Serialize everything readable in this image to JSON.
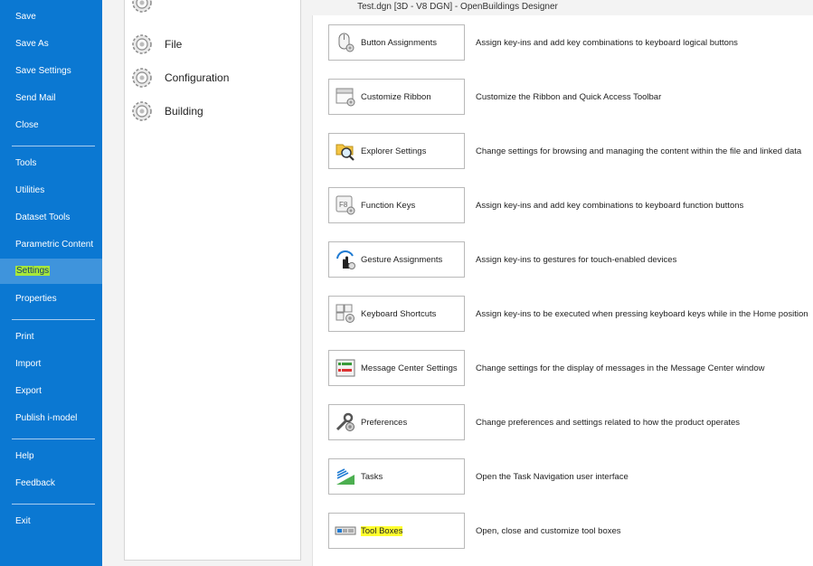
{
  "window": {
    "title": "Test.dgn [3D - V8 DGN] - OpenBuildings Designer"
  },
  "backstage": {
    "items": [
      {
        "label": "Save",
        "active": false
      },
      {
        "label": "Save As",
        "active": false
      },
      {
        "label": "Save Settings",
        "active": false
      },
      {
        "label": "Send Mail",
        "active": false
      },
      {
        "label": "Close",
        "active": false
      },
      {
        "label": "Tools",
        "active": false
      },
      {
        "label": "Utilities",
        "active": false
      },
      {
        "label": "Dataset Tools",
        "active": false
      },
      {
        "label": "Parametric Content",
        "active": false
      },
      {
        "label": "Settings",
        "active": true
      },
      {
        "label": "Properties",
        "active": false
      },
      {
        "label": "Print",
        "active": false
      },
      {
        "label": "Import",
        "active": false
      },
      {
        "label": "Export",
        "active": false
      },
      {
        "label": "Publish i-model",
        "active": false
      },
      {
        "label": "Help",
        "active": false
      },
      {
        "label": "Feedback",
        "active": false
      },
      {
        "label": "Exit",
        "active": false
      }
    ]
  },
  "categories": {
    "items": [
      {
        "label": "File",
        "icon": "gear-icon"
      },
      {
        "label": "Configuration",
        "icon": "gear-icon"
      },
      {
        "label": "Building",
        "icon": "gear-icon"
      }
    ]
  },
  "settings": {
    "items": [
      {
        "label": "Button Assignments",
        "desc": "Assign key-ins and add key combinations to keyboard logical buttons",
        "icon": "mouse-gear-icon"
      },
      {
        "label": "Customize Ribbon",
        "desc": "Customize the Ribbon and Quick Access Toolbar",
        "icon": "ribbon-gear-icon"
      },
      {
        "label": "Explorer Settings",
        "desc": "Change settings for browsing and managing the content within the file and linked data",
        "icon": "folder-search-icon"
      },
      {
        "label": "Function Keys",
        "desc": "Assign key-ins and add key combinations to keyboard function buttons",
        "icon": "function-key-icon"
      },
      {
        "label": "Gesture Assignments",
        "desc": "Assign key-ins to gestures for touch-enabled devices",
        "icon": "gesture-hand-icon"
      },
      {
        "label": "Keyboard Shortcuts",
        "desc": "Assign key-ins to be executed when pressing keyboard keys while in the Home position",
        "icon": "keyboard-gear-icon"
      },
      {
        "label": "Message Center Settings",
        "desc": "Change settings for the display of messages in the Message Center window",
        "icon": "message-center-icon"
      },
      {
        "label": "Preferences",
        "desc": "Change preferences and settings related to how the product operates",
        "icon": "wrench-gear-icon"
      },
      {
        "label": "Tasks",
        "desc": "Open the Task Navigation user interface",
        "icon": "tasks-icon"
      },
      {
        "label": "Tool Boxes",
        "desc": "Open, close and customize tool boxes",
        "icon": "toolbox-icon",
        "highlight": true
      }
    ]
  },
  "colors": {
    "backstage": "#0b78d2",
    "active_item": "#3f94dc",
    "highlight_green": "#a7e83a",
    "highlight_yellow": "#ffff2d"
  }
}
